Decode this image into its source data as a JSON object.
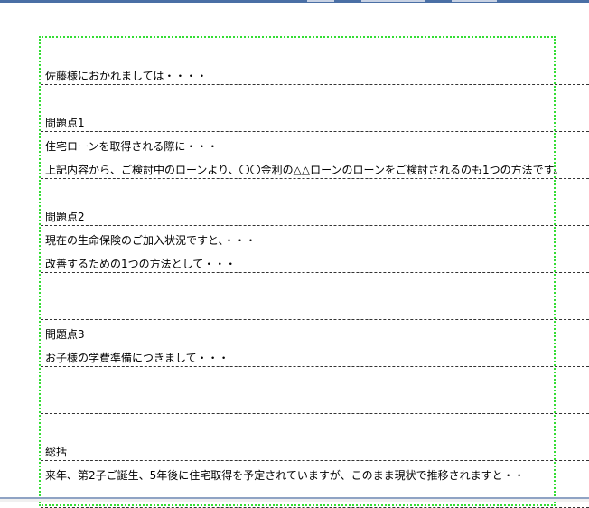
{
  "document": {
    "lines": [
      "",
      "佐藤様におかれましては・・・・",
      "",
      "問題点1",
      "住宅ローンを取得される際に・・・",
      "上記内容から、ご検討中のローンより、〇〇金利の△△ローンのローンをご検討されるのも1つの方法です。",
      "",
      "問題点2",
      "現在の生命保険のご加入状況ですと、・・・",
      "改善するための1つの方法として・・・",
      "",
      "",
      "問題点3",
      "お子様の学費準備につきまして・・・",
      "",
      "",
      "",
      "総括",
      "来年、第2子ご誕生、5年後に住宅取得を予定されていますが、このまま現状で推移されますと・・",
      "・・・・・"
    ]
  },
  "colors": {
    "frame": "#33dd33",
    "rule": "#333333",
    "accent": "#4a6fa5"
  }
}
